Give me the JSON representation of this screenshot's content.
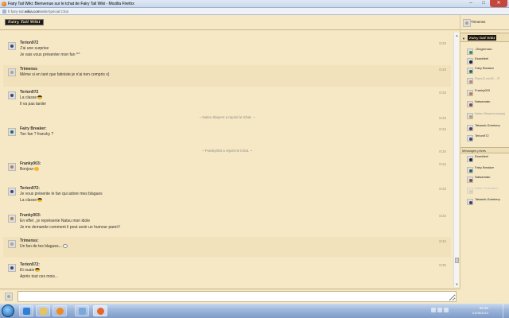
{
  "window": {
    "title": "Fairy Tail Wiki: Bienvenue sur le tchat de Fairy Tail Wiki - Mozilla Firefox",
    "url_host": "fr.fairy-tail.",
    "url_domain": "wikia.com",
    "url_path": "/wiki/Spécial:Chat",
    "min": "–",
    "max": "□",
    "close": "✕"
  },
  "header": {
    "logo_text": "Fairy Tail Wiki"
  },
  "current_user": {
    "name": "Trimenss"
  },
  "sidebar": {
    "room_logo": "Fairy Tail Wiki",
    "collapse_glyph": "▼",
    "users": [
      {
        "name": "-Gingerman-",
        "status": "active",
        "color": "#3a8f3a"
      },
      {
        "name": "Essekleel",
        "status": "active",
        "color": "#222222"
      },
      {
        "name": "Fairy Breaker",
        "status": "active",
        "color": "#2e6b4f"
      },
      {
        "name": "Flam-E-nic30 _.⚲",
        "status": "idle",
        "color": "#b88a6a"
      },
      {
        "name": "Franky003",
        "status": "active",
        "color": "#c07a3a"
      },
      {
        "name": "Natsamatu",
        "status": "active",
        "color": "#8a4a3a"
      },
      {
        "name": "Natsu Slayers (away)",
        "status": "idle",
        "color": "#c49a6c"
      },
      {
        "name": "Tataash-Greekery",
        "status": "active",
        "color": "#4a3a5a"
      },
      {
        "name": "Terion972",
        "status": "active",
        "color": "#3a4a6a"
      }
    ],
    "pm_header": "Messages privés",
    "pm_users": [
      {
        "name": "Essekleel",
        "status": "active",
        "color": "#222222"
      },
      {
        "name": "Fairy Breaker",
        "status": "active",
        "color": "#2e6b4f"
      },
      {
        "name": "Natsamatu",
        "status": "active",
        "color": "#8a4a3a"
      },
      {
        "name": "Natsu Evilication",
        "status": "offline",
        "color": "#aaaaaa"
      },
      {
        "name": "Tataash-Greekery",
        "status": "active",
        "color": "#4a3a5a"
      }
    ]
  },
  "chat": {
    "messages": [
      {
        "user": "Terion972",
        "time": "8:33",
        "lines": [
          "J'ai une surprise",
          "Je vais vous présenter mon fan ^^"
        ],
        "emoji": [
          null,
          null
        ],
        "alt": false,
        "color": "#3a4a6a"
      },
      {
        "user": "Trimenss",
        "time": "8:33",
        "lines": [
          "Même si en tant que fatiniste je n'ai rien compris x)"
        ],
        "emoji": [
          null
        ],
        "alt": true,
        "color": "#b5a480"
      },
      {
        "user": "Terion972",
        "time": "8:33",
        "lines": [
          "La classe",
          "Il va pas tarder"
        ],
        "emoji": [
          "cool",
          null
        ],
        "alt": false,
        "color": "#3a4a6a"
      },
      {
        "user": "Fairy Breaker:",
        "time": "8:34",
        "lines": [
          "Ton fan ? francky ?"
        ],
        "emoji": [
          null
        ],
        "alt": false,
        "color": "#2e6b4f"
      },
      {
        "user": "Franky003:",
        "time": "8:34",
        "lines": [
          "Bonjour"
        ],
        "emoji": [
          "smile"
        ],
        "alt": false,
        "color": "#c07a3a"
      },
      {
        "user": "Terion972:",
        "time": "8:34",
        "lines": [
          "Je vous présente le fan qui adore mes blagues",
          "La classe"
        ],
        "emoji": [
          null,
          "cool"
        ],
        "alt": false,
        "color": "#3a4a6a"
      },
      {
        "user": "Franky003:",
        "time": "8:34",
        "lines": [
          "En effet , je représente Natsu mon idole",
          "Je me demande comment il peut avoir un humour pareil !"
        ],
        "emoji": [
          null,
          null
        ],
        "alt": false,
        "color": "#c07a3a"
      },
      {
        "user": "Trimenss:",
        "time": "8:34",
        "lines": [
          "Un fan de tes blagues..."
        ],
        "emoji": [
          "neutral"
        ],
        "alt": true,
        "color": "#b5a480"
      },
      {
        "user": "Terion972:",
        "time": "8:35",
        "lines": [
          "Et ouais",
          "Après tout ces mois..."
        ],
        "emoji": [
          "cool",
          null
        ],
        "alt": false,
        "color": "#3a4a6a"
      }
    ],
    "inline_alerts": [
      {
        "text": "~ Natsu Slayers a rejoint le tchat. ~",
        "time": "8:33"
      },
      {
        "text": "~ Franky003 a rejoint le tchat. ~",
        "time": "8:34"
      }
    ]
  },
  "input": {
    "value": ""
  },
  "taskbar": {
    "time": "08:35",
    "date": "01/06/2014",
    "apps": [
      {
        "name": "ie",
        "color": "#2f7fd6"
      },
      {
        "name": "explorer",
        "color": "#e6c35c"
      },
      {
        "name": "media-player",
        "color": "#f08a1e"
      },
      {
        "name": "paint",
        "color": "#7aa8d8"
      },
      {
        "name": "firefox",
        "color": "#e5662a"
      }
    ]
  }
}
